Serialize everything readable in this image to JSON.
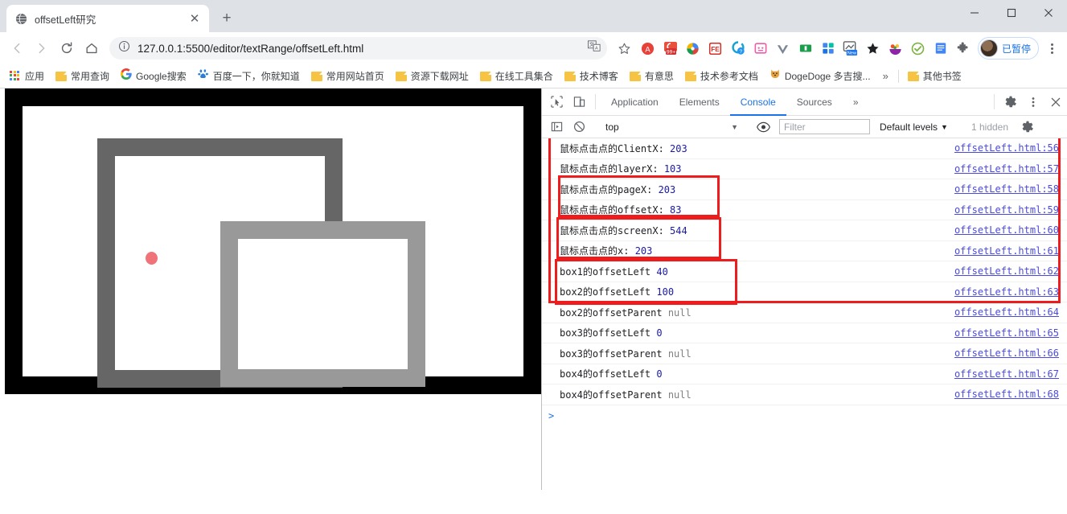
{
  "window": {
    "controls": [
      {
        "name": "minimize",
        "glyph": "minimize"
      },
      {
        "name": "maximize",
        "glyph": "maximize"
      },
      {
        "name": "close",
        "glyph": "close"
      }
    ]
  },
  "tab": {
    "title": "offsetLeft研究",
    "favicon": "globe-icon",
    "close_label": "✕",
    "newtab_label": "+"
  },
  "toolbar": {
    "back": "back-arrow-icon",
    "forward": "forward-arrow-icon",
    "reload": "reload-icon",
    "home": "home-icon",
    "url": "127.0.0.1:5500/editor/textRange/offsetLeft.html",
    "info_icon": "info-circle-icon",
    "translate_icon": "translate-icon",
    "star_icon": "star-outline-icon",
    "profile_label": "已暂停",
    "menu_icon": "three-dot-menu-icon"
  },
  "extensions": [
    {
      "name": "adblock-extension",
      "color": "#e8413a",
      "glyph": "A"
    },
    {
      "name": "counter-extension",
      "color": "#d93025",
      "glyph": "99+"
    },
    {
      "name": "colorpicker-extension",
      "color": "#f4b400",
      "glyph": "◉"
    },
    {
      "name": "fe-extension",
      "color": "#d93025",
      "glyph": "FE"
    },
    {
      "name": "question-extension",
      "color": "#1a9cd8",
      "glyph": "Q"
    },
    {
      "name": "pink-extension",
      "color": "#f06292",
      "glyph": "▣"
    },
    {
      "name": "vue-extension",
      "color": "#6b7a8f",
      "glyph": "V"
    },
    {
      "name": "green-extension",
      "color": "#34a853",
      "glyph": "▰"
    },
    {
      "name": "blocks-extension",
      "color": "#4285f4",
      "glyph": "⠿"
    },
    {
      "name": "new-extension",
      "color": "#1a73e8",
      "glyph": "New"
    },
    {
      "name": "star-extension",
      "color": "#202124",
      "glyph": "★"
    },
    {
      "name": "fruit-extension",
      "color": "#8e24aa",
      "glyph": "◕"
    },
    {
      "name": "check-extension",
      "color": "#7cb342",
      "glyph": "✓"
    },
    {
      "name": "note-extension",
      "color": "#4285f4",
      "glyph": "▤"
    },
    {
      "name": "puzzle-extension",
      "color": "#5f6368",
      "glyph": "🧩"
    }
  ],
  "bookmarks": {
    "items": [
      {
        "label": "应用",
        "icon": "apps-grid-icon"
      },
      {
        "label": "常用查询",
        "icon": "folder-icon"
      },
      {
        "label": "Google搜索",
        "icon": "google-icon"
      },
      {
        "label": "百度一下，你就知道",
        "icon": "baidu-icon"
      },
      {
        "label": "常用网站首页",
        "icon": "folder-icon"
      },
      {
        "label": "资源下载网址",
        "icon": "folder-icon"
      },
      {
        "label": "在线工具集合",
        "icon": "folder-icon"
      },
      {
        "label": "技术博客",
        "icon": "folder-icon"
      },
      {
        "label": "有意思",
        "icon": "folder-icon"
      },
      {
        "label": "技术参考文档",
        "icon": "folder-icon"
      },
      {
        "label": "DogeDoge 多吉搜...",
        "icon": "doge-icon"
      }
    ],
    "overflow_label": "»",
    "other_label": "其他书签",
    "other_icon": "folder-icon"
  },
  "page_demo": {
    "box1_name": "box1-black-frame",
    "box2_name": "box2-dark-gray",
    "box3_name": "box3-mid-gray",
    "dot_name": "click-marker-dot",
    "colors": {
      "box1": "#000000",
      "box2": "#666666",
      "box3": "#999999",
      "dot": "#f1737a"
    }
  },
  "devtools": {
    "inspect_icon": "cursor-inspect-icon",
    "device_icon": "device-toggle-icon",
    "tabs": [
      {
        "label": "Application",
        "active": false
      },
      {
        "label": "Elements",
        "active": false
      },
      {
        "label": "Console",
        "active": true
      },
      {
        "label": "Sources",
        "active": false
      }
    ],
    "more_tabs": "»",
    "settings_icon": "gear-icon",
    "kebab_icon": "three-dot-menu-icon",
    "close_icon": "close-icon",
    "filterbar": {
      "sidebar_icon": "console-sidebar-icon",
      "clear_icon": "clear-console-icon",
      "context": "top",
      "context_caret": "▼",
      "eye_icon": "eye-icon",
      "filter_placeholder": "Filter",
      "levels_label": "Default levels",
      "levels_caret": "▼",
      "hidden_label": "1 hidden",
      "settings_icon": "gear-icon"
    },
    "logs": [
      {
        "text": "鼠标点击点的ClientX: ",
        "value": "203",
        "vtype": "num",
        "source": "offsetLeft.html:56"
      },
      {
        "text": "鼠标点击点的layerX: ",
        "value": "103",
        "vtype": "num",
        "source": "offsetLeft.html:57"
      },
      {
        "text": "鼠标点击点的pageX: ",
        "value": "203",
        "vtype": "num",
        "source": "offsetLeft.html:58"
      },
      {
        "text": "鼠标点击点的offsetX: ",
        "value": "83",
        "vtype": "num",
        "source": "offsetLeft.html:59"
      },
      {
        "text": "鼠标点击点的screenX: ",
        "value": "544",
        "vtype": "num",
        "source": "offsetLeft.html:60"
      },
      {
        "text": "鼠标点击点的x: ",
        "value": "203",
        "vtype": "num",
        "source": "offsetLeft.html:61"
      },
      {
        "text": "box1的offsetLeft ",
        "value": "40",
        "vtype": "num",
        "source": "offsetLeft.html:62"
      },
      {
        "text": "box2的offsetLeft ",
        "value": "100",
        "vtype": "num",
        "source": "offsetLeft.html:63"
      },
      {
        "text": "box2的offsetParent ",
        "value": "null",
        "vtype": "nul",
        "source": "offsetLeft.html:64"
      },
      {
        "text": "box3的offsetLeft ",
        "value": "0",
        "vtype": "num",
        "source": "offsetLeft.html:65"
      },
      {
        "text": "box3的offsetParent ",
        "value": "null",
        "vtype": "nul",
        "source": "offsetLeft.html:66"
      },
      {
        "text": "box4的offsetLeft ",
        "value": "0",
        "vtype": "num",
        "source": "offsetLeft.html:67"
      },
      {
        "text": "box4的offsetParent ",
        "value": "null",
        "vtype": "nul",
        "source": "offsetLeft.html:68"
      }
    ],
    "prompt": ">",
    "annotation_color": "#ee1c1c"
  }
}
